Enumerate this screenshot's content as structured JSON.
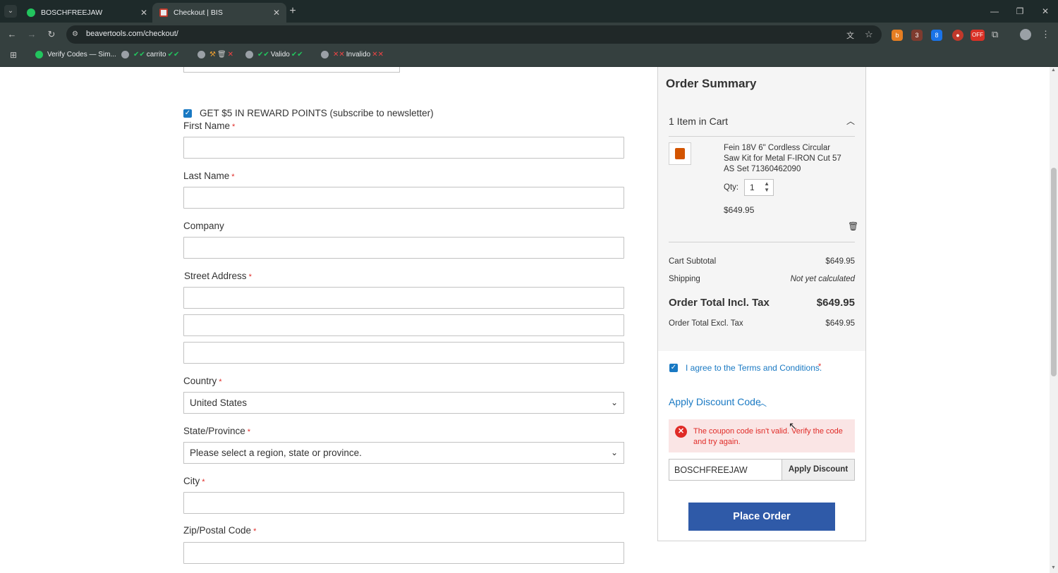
{
  "browser": {
    "tabs": [
      {
        "label": "BOSCHFREEJAW",
        "active": false
      },
      {
        "label": "Checkout | BIS",
        "active": true
      }
    ],
    "url": "beavertools.com/checkout/",
    "bookmarks": [
      {
        "label": "Verify Codes — Sim..."
      },
      {
        "label": "carrito"
      },
      {
        "label": ""
      },
      {
        "label": "Valido"
      },
      {
        "label": "Invalido"
      }
    ]
  },
  "form": {
    "newsletter_label": "GET $5 IN REWARD POINTS (subscribe to newsletter)",
    "newsletter_checked": true,
    "first_name_label": "First Name",
    "last_name_label": "Last Name",
    "company_label": "Company",
    "street_label": "Street Address",
    "country_label": "Country",
    "country_value": "United States",
    "state_label": "State/Province",
    "state_value": "Please select a region, state or province.",
    "city_label": "City",
    "zip_label": "Zip/Postal Code",
    "required_mark": "*"
  },
  "summary": {
    "title": "Order Summary",
    "items_in_cart": "1 Item in Cart",
    "product_name": "Fein 18V 6\" Cordless Circular Saw Kit for Metal F-IRON Cut 57 AS Set 71360462090",
    "qty_label": "Qty:",
    "qty_value": "1",
    "product_price": "$649.95",
    "subtotal_label": "Cart Subtotal",
    "subtotal_value": "$649.95",
    "shipping_label": "Shipping",
    "shipping_value": "Not yet calculated",
    "total_incl_label": "Order Total Incl. Tax",
    "total_incl_value": "$649.95",
    "total_excl_label": "Order Total Excl. Tax",
    "total_excl_value": "$649.95",
    "terms_label": "I agree to the Terms and Conditions.",
    "discount_toggle": "Apply Discount Code",
    "error_message": "The coupon code isn't valid. Verify the code and try again.",
    "coupon_value": "BOSCHFREEJAW",
    "apply_button": "Apply Discount",
    "place_order": "Place Order"
  },
  "colors": {
    "link": "#1979c3",
    "error_bg": "#fae5e5",
    "error_text": "#e02b27",
    "primary_button": "#2f5aa8"
  }
}
